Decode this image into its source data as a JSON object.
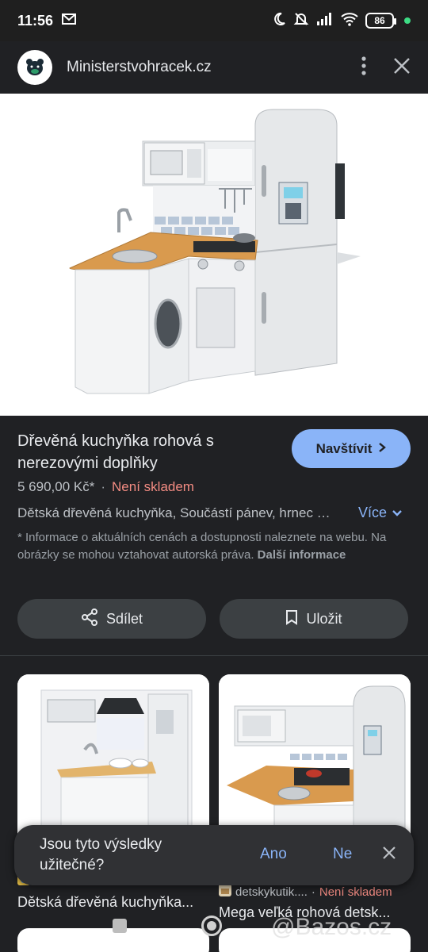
{
  "status": {
    "time": "11:56",
    "battery": "86"
  },
  "site": {
    "name": "Ministerstvohracek.cz"
  },
  "product": {
    "title": "Dřevěná kuchyňka rohová s nerezovými doplňky",
    "visit_label": "Navštívit",
    "price": "5 690,00 Kč*",
    "separator": "·",
    "stock": "Není skladem",
    "description": "Dětská dřevěná kuchyňka, Součástí pánev, hrnec …",
    "more_label": "Více",
    "note_text": "* Informace o aktuálních cenách a dostupnosti naleznete na webu. Na obrázky se mohou vztahovat autorská práva.",
    "note_link": "Další informace",
    "share_label": "Sdílet",
    "save_label": "Uložit"
  },
  "related": [
    {
      "title": "Dětská dřevěná kuchyňka..."
    },
    {
      "source": "detskykutik....",
      "separator": "·",
      "stock": "Není skladem",
      "title": "Mega veľká rohová detsk..."
    }
  ],
  "feedback": {
    "question": "Jsou tyto výsledky užitečné?",
    "yes": "Ano",
    "no": "Ne"
  },
  "watermark": "@Bazos.cz",
  "colors": {
    "accent": "#8ab4f8",
    "stock_red": "#f28b82",
    "background": "#202124"
  }
}
